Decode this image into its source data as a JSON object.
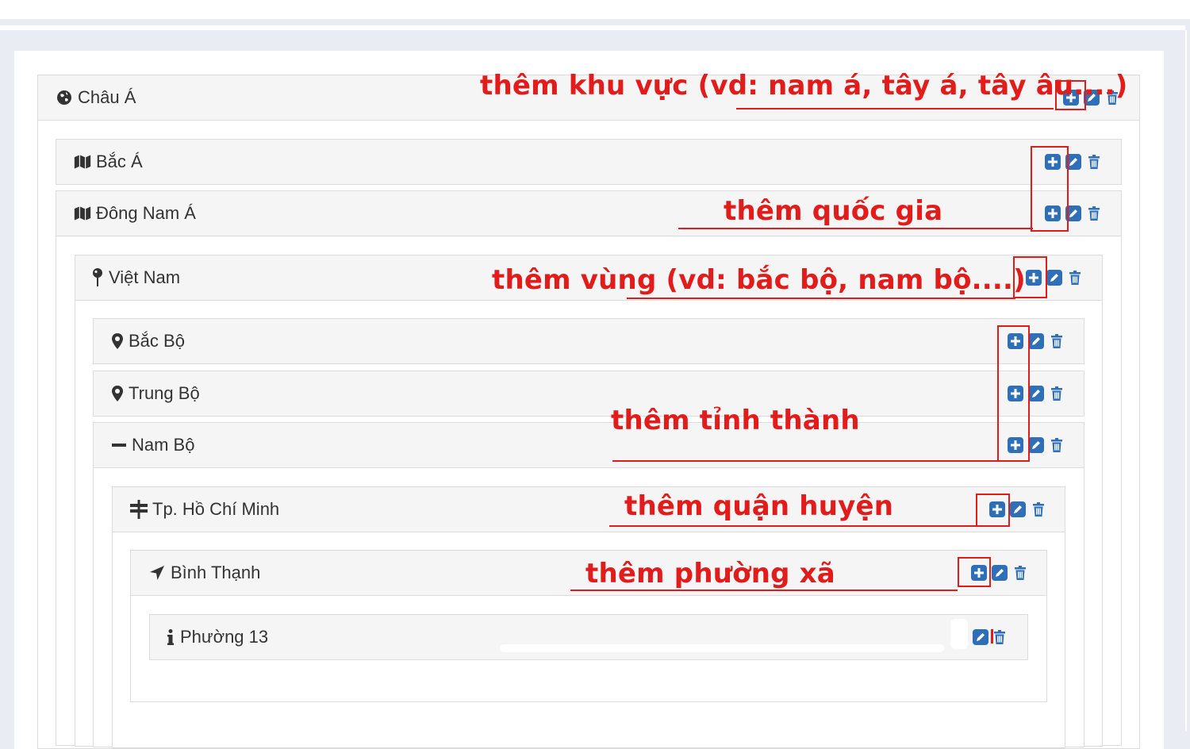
{
  "colors": {
    "accent": "#2f6fb8",
    "annotation": "#e21b1b",
    "header_bg": "#f5f5f5",
    "border": "#dcdcdc"
  },
  "tree": {
    "continent": {
      "label": "Châu Á",
      "icon": "globe-icon"
    },
    "regions": [
      {
        "label": "Bắc Á",
        "icon": "map-icon"
      },
      {
        "label": "Đông Nam Á",
        "icon": "map-icon"
      }
    ],
    "country": {
      "label": "Việt Nam",
      "icon": "map-pin-icon"
    },
    "zones": [
      {
        "label": "Bắc Bộ",
        "icon": "map-marker-icon"
      },
      {
        "label": "Trung Bộ",
        "icon": "map-marker-icon"
      },
      {
        "label": "Nam Bộ",
        "icon": "minus-icon"
      }
    ],
    "province": {
      "label": "Tp. Hồ Chí Minh",
      "icon": "signpost-icon"
    },
    "district": {
      "label": "Bình Thạnh",
      "icon": "location-arrow-icon"
    },
    "ward": {
      "label": "Phường 13",
      "icon": "info-icon"
    }
  },
  "annotations": {
    "add_area": "thêm khu vực (vd: nam á, tây á, tây âu....)",
    "add_country": "thêm quốc gia",
    "add_zone": "thêm vùng (vd: bắc bộ, nam bộ....)",
    "add_province": "thêm tỉnh thành",
    "add_district": "thêm quận huyện",
    "add_ward": "thêm phường xã"
  }
}
